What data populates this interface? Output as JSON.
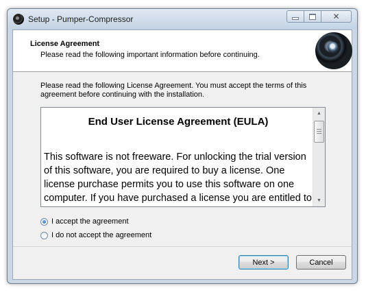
{
  "window": {
    "title": "Setup - Pumper-Compressor",
    "controls": {
      "minimize": "minimize",
      "maximize": "maximize",
      "close": "✕"
    }
  },
  "header": {
    "title": "License Agreement",
    "subtitle": "Please read the following important information before continuing."
  },
  "intro_text": "Please read the following License Agreement. You must accept the terms of this agreement before continuing with the installation.",
  "eula": {
    "heading": "End User License Agreement (EULA)",
    "body": "This software is not freeware. For unlocking the trial version of this software, you are required to buy a license. One license purchase permits you to use this software on one computer. If you have purchased a license you are entitled to free updates until the next major version number. Note that"
  },
  "options": {
    "accept": {
      "label": "I accept the agreement",
      "checked": true
    },
    "decline": {
      "label": "I do not accept the agreement",
      "checked": false
    }
  },
  "buttons": {
    "next": "Next >",
    "cancel": "Cancel"
  },
  "icons": {
    "scroll_up": "▲",
    "scroll_down": "▼"
  }
}
